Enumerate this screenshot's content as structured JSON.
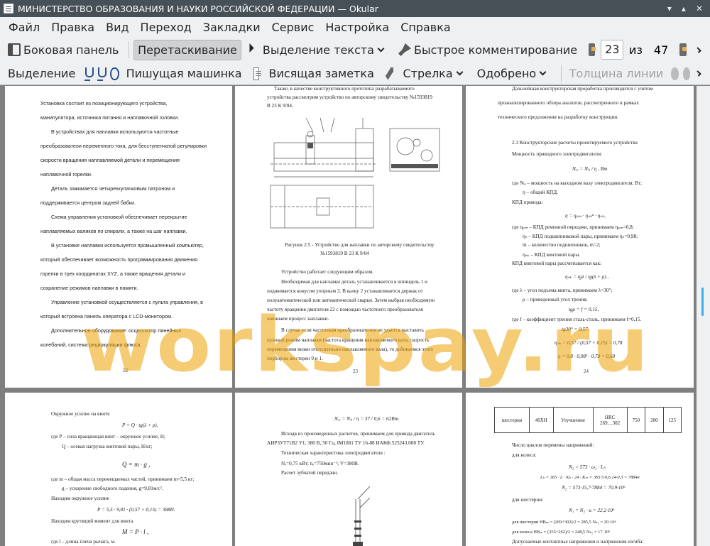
{
  "window": {
    "title": "МИНИСТЕРСТВО ОБРАЗОВАНИЯ И НАУКИ РОССИЙСКОЙ ФЕДЕРАЦИИ  — Okular"
  },
  "menu": [
    "Файл",
    "Правка",
    "Вид",
    "Переход",
    "Закладки",
    "Сервис",
    "Настройка",
    "Справка"
  ],
  "toolbar": {
    "sidebar": "Боковая панель",
    "drag": "Перетаскивание",
    "text_select": "Выделение текста",
    "quick_comment": "Быстрое комментирование",
    "page": "23",
    "of": "из",
    "total": "47"
  },
  "annot": {
    "select": "Выделение",
    "typewriter": "Пишущая машинка",
    "note": "Висящая заметка",
    "arrow": "Стрелка",
    "approved": "Одобрено",
    "line_width": "Толщина линии"
  },
  "watermark": "workspay.ru",
  "pages": {
    "p22": {
      "lines": [
        "Установка      состоит      из      позиционирующего      устройства,",
        "манипулятора, источника питания и наплавочной головки.",
        "В   устройствах   для   наплавки   используются   частотные",
        "преобразователи переменного тока, для бесступенчатой регулировки",
        "скорости   вращения   наплавляемой   детали   и   перемещения",
        "наплавочной горелки.",
        "Деталь    зажимается    четырехкулачковым    патроном    и",
        "поддерживается центром задней бабки.",
        "Схема   управления   установкой   обеспечивает   перекрытие",
        "наплавляемых валиков по спирали, а также на шаг наплавки.",
        "В установке наплавки используется промышленный компьютер,",
        "который   обеспечивает   возможность   программирования   движения",
        "горелки в трех координатах XYZ, а также вращения детали и",
        "сохранение режимов наплавки в памяти.",
        "Управление установкой осуществляется с пульта управления, в",
        "который встроена панель оператора с LCD-монитором.",
        "Дополнительное      оборудование:      осциллятор      линейных",
        "колебаний, система рециркуляции флюса."
      ],
      "num": "22"
    },
    "p23": {
      "top": [
        "Также,  в  качестве  конструктивного  прототипа  разрабатываемого",
        "устройства рассмотрим устройство по авторскому свидетельству №1593819",
        "В 23 К 9/04."
      ],
      "caption": [
        "Рисунок 2.5 - Устройство для наплавки по авторскому свидетельству",
        "№1593819 В 23 К 9/04"
      ],
      "body": [
        "Устройство работает следующим образом.",
        "Необходимая для наплавки деталь устанавливается в шпиндель 1 и",
        "поджимается конусом упорным 3. В валку 2 устанавливается держак от",
        "полуавтоматической или автоматической сварки. Затем выбрав необходимую",
        "частоту вращения двигателя 22 с помощью частотного преобразователя",
        "начинаем процесс наплавки.",
        "В  случае  если  частотным  преобразователем  не  удается  выставить",
        "нужный  режим  наплавки  (частота  вращения  наплавляемого  вала,  скорость",
        "перемещения  визки  относительно  наплавляемого  вала),  то  добиваемся  этого",
        "подбором шестерен 9 и 1."
      ],
      "num": "23"
    },
    "p24": {
      "lines": [
        "Дальнейшая конструкторская проработка производится с учетом",
        "проанализированного   обзора   аналогов,   рассмотренного   в   рамках",
        "технического предложения на разработку конструкции.",
        "2.3 Конструкторские расчеты проектируемого устройства",
        "Мощность приводного электродвигателя:",
        "Nₑₓ = Nₗₐ / η , Вт",
        "где Nₗₐ – мощность на выходном валу электродвигателя, Вт;",
        "η – общий КПД.",
        "КПД привода:",
        "η = ηₚₘ · ηₙₖⁿ · ηₙₖ,",
        "где ηₚₘ – КПД ременной передачи, принимаем ηₚₘ=0,8;",
        "ηₙ – КПД подшипниковой пары, принимаем ηₙ=0,98;",
        "m – количество подшипников, m=2;",
        "ηₙₖ – КПД винтовой пары.",
        "КПД винтовой пары рассчитывается как:",
        "ηₙₖ = tgλ / tg(λ + ρ) ,",
        "где λ – угол подъема винта, принимаем λ=30°;",
        "ρ – приведенный угол трения,",
        "tgρ = f = 0,15,",
        "где f – коэффициент трения сталь-сталь, принимаем f=0,15.",
        "tg30° = 0,57.",
        "ηₙₖ = 0,57 / (0,57 + 0,15) = 0,78",
        "η = 0,8 · 0,98² · 0,78 = 0,60"
      ],
      "num": "24"
    },
    "p22b": {
      "lines": [
        "Окружное усилие на винте",
        "P = Q · tg(λ + ρ),",
        "где P – сила вращающая винт – окружное усилие, Н;",
        "Q – осевая нагрузка винтовой пары, Н/кг;",
        "Q = m · g ,",
        "где m – общая масса перемещаемых частей, принимаем m=5,5 кг;",
        "g – ускорение свободного падения, g=9,81м/с².",
        "Находим окружное усилие",
        "P = 5,5 · 9,81 · (0,57 + 0,15) = 388Н.",
        "Находим крутящий момент для винта",
        "M = P · l ,",
        "где l – длина плеча рычага, м."
      ]
    },
    "p23b": {
      "lines": [
        "Nₑₓ = Nₗₐ / η = 37 / 0,6 = 62Вт.",
        "Исходя из произведенных расчетов, принимаем для привода двигатель",
        "АИР3УТ71В2 У1, 380 В, 50 Гц, IM1081 ТУ 16-88 ИАКФ.525243.008 ТУ.",
        "Техническая характеристика электродвигателя :",
        "Nₑ=0,75 кВт; nₑ=750мин⁻¹; V=380В.",
        "Расчет зубчатой передачи."
      ]
    },
    "p24b": {
      "table": [
        "шестерня",
        "40ХН",
        "Улучшение",
        "HRC",
        "269…302",
        "750",
        "200",
        "125"
      ],
      "lines": [
        "Число циклов перемены напряжений:",
        "для колеса:",
        "N₂ = 573 · ω₂ · Lₕ",
        "Lₕ = 365 · L · Kₕ · 24 · Kₘ = 365·5·0,6·24·0,3 = 7884ч",
        "N₂ = 573·15,7·7884 = 70,9·10⁶",
        "для шестерни:",
        "N₁ = N₂ · u = 22,2·10⁶",
        "для шестерни   HBₘ = (269+302)/2 = 285,5   Nₕ₁ = 20·10⁶",
        "для колеса   HBₘ = (255+262)/2 = 248,5   Nₕ₂ = 17·10⁶",
        "Допускаемые контактные напряжения и напряжения изгиба:"
      ]
    }
  }
}
